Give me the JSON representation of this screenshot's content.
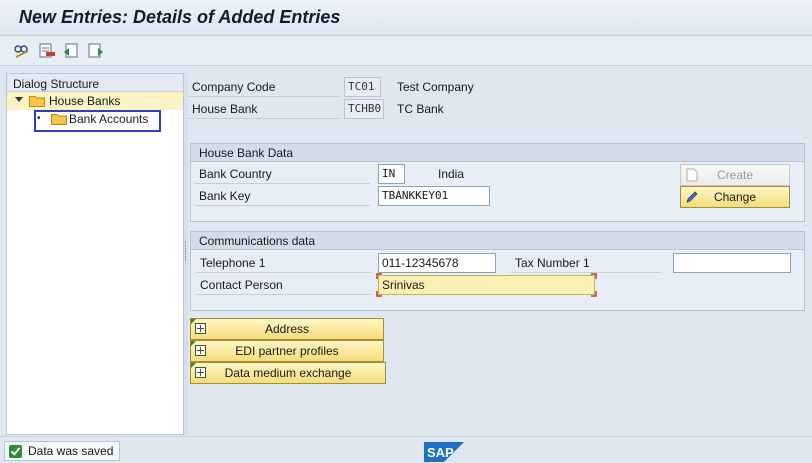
{
  "window": {
    "title": "New Entries: Details of Added Entries"
  },
  "toolbar": {
    "icons": [
      "change-display-icon",
      "delete-icon",
      "undo-icon",
      "next-entry-icon"
    ]
  },
  "dialog_structure": {
    "header": "Dialog Structure",
    "items": [
      {
        "label": "House Banks",
        "expanded": true
      },
      {
        "label": "Bank Accounts",
        "selected": true
      }
    ]
  },
  "header_fields": {
    "company_code_label": "Company Code",
    "company_code_value": "TC01",
    "company_code_desc": "Test Company",
    "house_bank_label": "House Bank",
    "house_bank_value": "TCHB0",
    "house_bank_desc": "TC Bank"
  },
  "house_bank_data": {
    "title": "House Bank Data",
    "bank_country_label": "Bank Country",
    "bank_country_value": "IN",
    "bank_country_desc": "India",
    "bank_key_label": "Bank Key",
    "bank_key_value": "TBANKKEY01",
    "create_label": "Create",
    "change_label": "Change"
  },
  "communications": {
    "title": "Communications data",
    "telephone_label": "Telephone 1",
    "telephone_value": "011-12345678",
    "tax_label": "Tax Number 1",
    "tax_value": "",
    "contact_label": "Contact Person",
    "contact_value": "Srinivas"
  },
  "buttons": {
    "address": "Address",
    "edi": "EDI partner profiles",
    "dme": "Data medium exchange"
  },
  "status": {
    "message": "Data was saved",
    "type": "success",
    "logo": "SAP"
  }
}
